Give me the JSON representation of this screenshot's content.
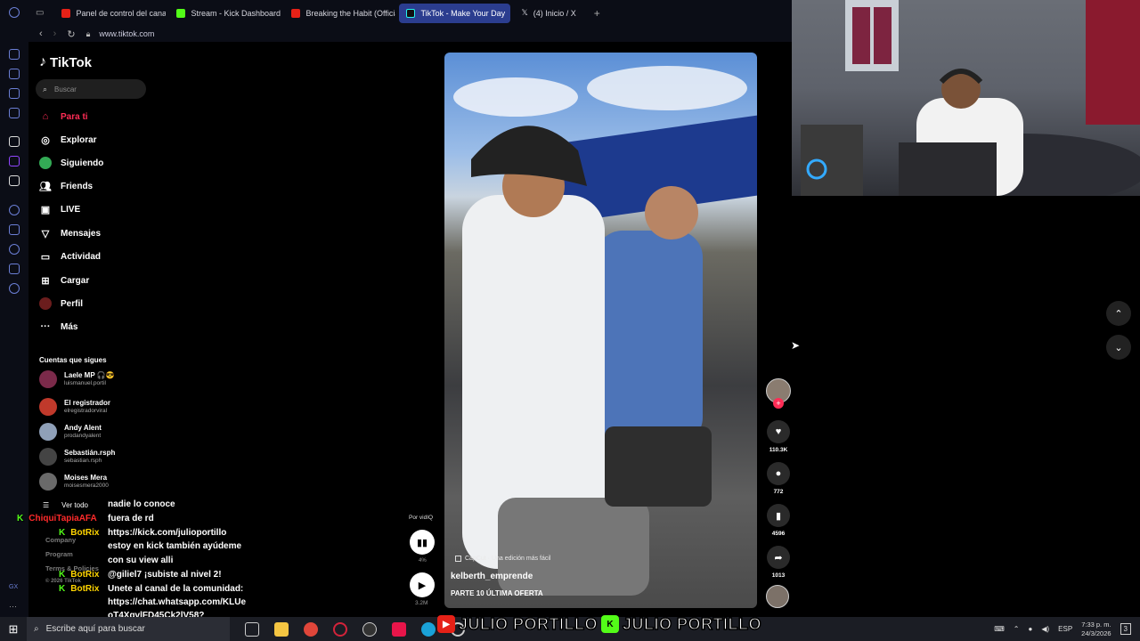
{
  "browser": {
    "tabs": [
      {
        "label": "Panel de control del canal",
        "favicon_color": "#e62117"
      },
      {
        "label": "Stream - Kick Dashboard",
        "favicon_color": "#53fc18"
      },
      {
        "label": "Breaking the Habit (Officia",
        "favicon_color": "#e62117"
      },
      {
        "label": "TikTok - Make Your Day",
        "favicon_color": "#000000",
        "active": true
      },
      {
        "label": "(4) Inicio / X",
        "favicon_color": "#ffffff"
      }
    ],
    "new_tab": "+",
    "url": "www.tiktok.com"
  },
  "tiktok": {
    "logo": "TikTok",
    "search_placeholder": "Buscar",
    "nav": [
      {
        "label": "Para ti",
        "icon": "home-icon",
        "active": true
      },
      {
        "label": "Explorar",
        "icon": "compass-icon"
      },
      {
        "label": "Siguiendo",
        "icon": "following-icon"
      },
      {
        "label": "Friends",
        "icon": "friends-icon"
      },
      {
        "label": "LIVE",
        "icon": "live-icon"
      },
      {
        "label": "Mensajes",
        "icon": "messages-icon"
      },
      {
        "label": "Actividad",
        "icon": "activity-icon"
      },
      {
        "label": "Cargar",
        "icon": "upload-icon"
      },
      {
        "label": "Perfil",
        "icon": "profile-icon"
      },
      {
        "label": "Más",
        "icon": "more-icon"
      }
    ],
    "following_title": "Cuentas que sigues",
    "accounts": [
      {
        "name": "Laele MP 🎧😎",
        "handle": "luismanuel.portil"
      },
      {
        "name": "El registrador",
        "handle": "elregistradorviral"
      },
      {
        "name": "Andy  Alent",
        "handle": "prodandyalent"
      },
      {
        "name": "Sebastián.rsph",
        "handle": "sebastian.rsph"
      },
      {
        "name": "Moises Mera",
        "handle": "moisesmera2000"
      }
    ],
    "see_all": "Ver todo",
    "footer": [
      "Company",
      "Program",
      "Terms & Policies",
      "© 2026 TikTok"
    ],
    "video": {
      "capcut": "CapCut · Una edición más fácil",
      "author": "kelberth_emprende",
      "description": "PARTE 10 ÚLTIMA OFERTA"
    },
    "vidiq": {
      "label": "Por vidIQ",
      "percent": "4%",
      "views": "3.2M"
    },
    "actions": {
      "likes": "110.3K",
      "comments": "772",
      "saves": "4596",
      "shares": "1013"
    },
    "accent": "#fe2c55"
  },
  "chat": [
    {
      "user": "",
      "text": "nadie lo conoce"
    },
    {
      "user": "ChiquiTapiaAFA",
      "text": "fuera de rd",
      "color": "#ff2a2a"
    },
    {
      "user": "BotRix",
      "text": "https://kick.com/julioportillo",
      "color": "#ffd500"
    },
    {
      "user": "",
      "text": "estoy en kick también ayúdeme"
    },
    {
      "user": "",
      "text": "con su view alli"
    },
    {
      "user": "BotRix",
      "text": "@giliel7 ¡subiste al nivel 2!",
      "color": "#ffd500"
    },
    {
      "user": "BotRix",
      "text": "Unete al canal de la comunidad:",
      "color": "#ffd500"
    },
    {
      "user": "",
      "text": "https://chat.whatsapp.com/KLUe"
    },
    {
      "user": "",
      "text": "oT4XgvlFD45Ck2lV58?"
    }
  ],
  "taskbar": {
    "search_placeholder": "Escribe aquí para buscar",
    "banner": [
      "JULIO PORTILLO",
      "JULIO PORTILLO"
    ],
    "lang": "ESP",
    "time": "7:33 p. m.",
    "date": "24/3/2026",
    "notifications": "3"
  }
}
